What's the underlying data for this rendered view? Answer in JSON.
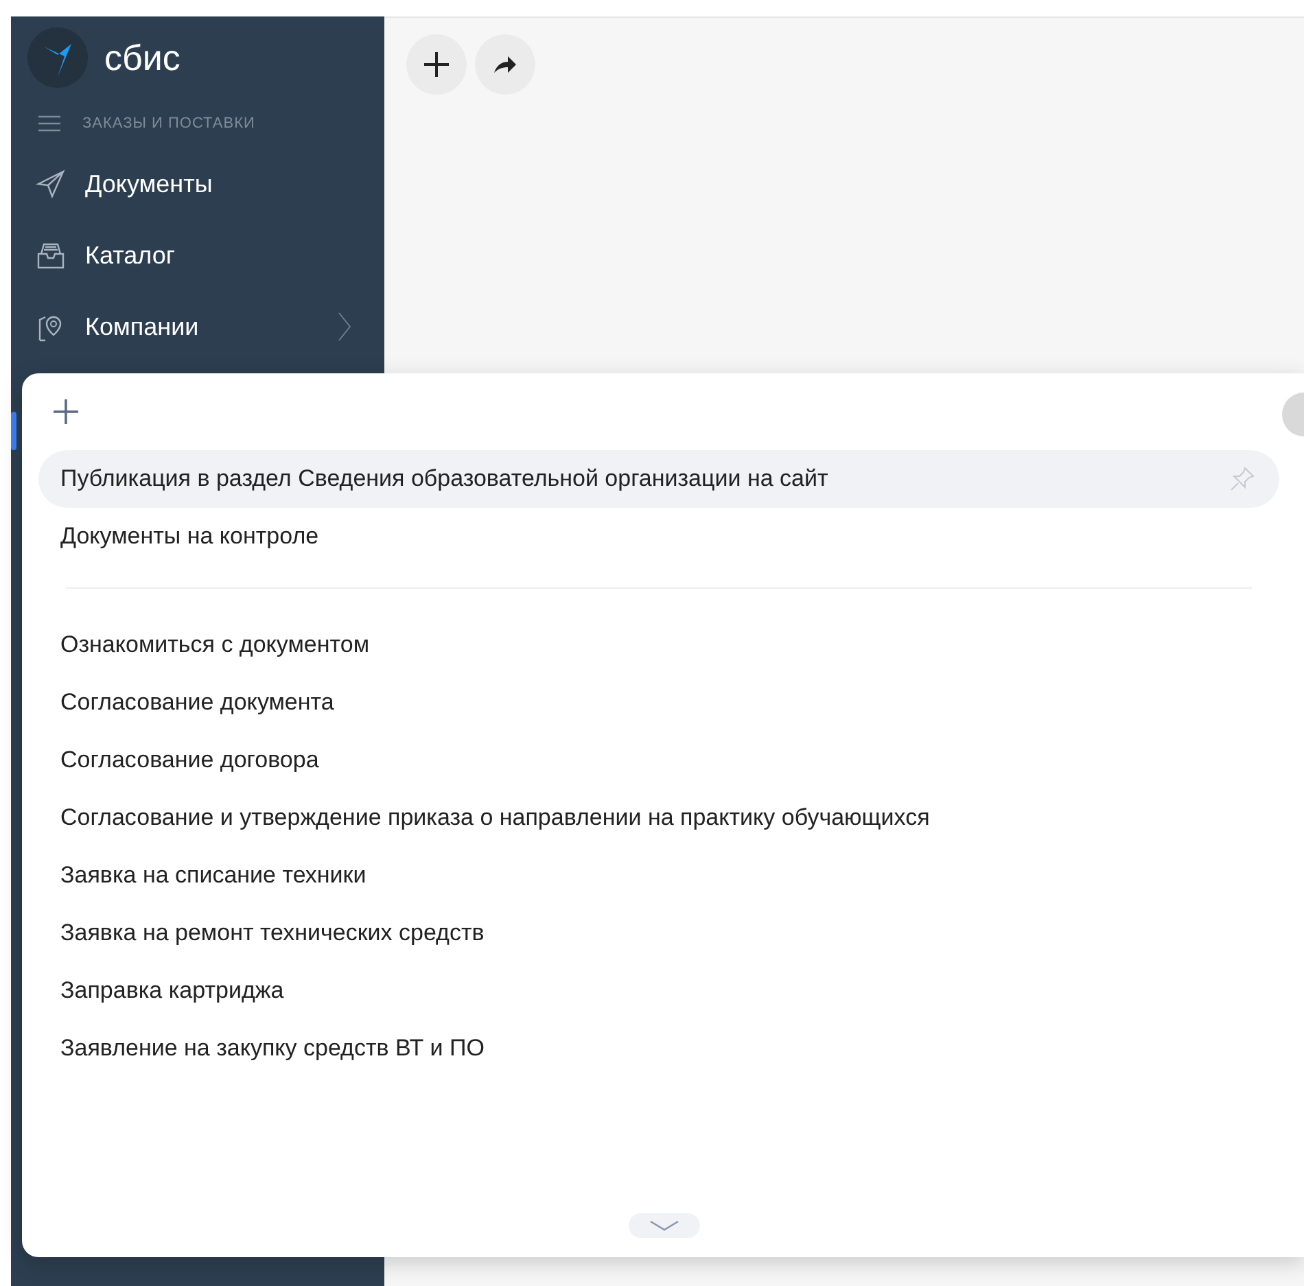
{
  "sidebar": {
    "logo": "сбис",
    "section": "ЗАКАЗЫ И ПОСТАВКИ",
    "items": [
      {
        "kind": "send",
        "label": "Документы",
        "expandable": false
      },
      {
        "kind": "tray",
        "label": "Каталог",
        "expandable": false
      },
      {
        "kind": "pin",
        "label": "Компании",
        "expandable": true
      }
    ]
  },
  "toolbar": {
    "buttons": [
      {
        "kind": "plus"
      },
      {
        "kind": "forward"
      }
    ]
  },
  "popup": {
    "groups": [
      [
        {
          "label": "Публикация в раздел Сведения образовательной организации на сайт",
          "selected": true
        },
        {
          "label": "Документы на контроле",
          "selected": false
        }
      ],
      [
        {
          "label": "Ознакомиться с документом",
          "selected": false
        },
        {
          "label": "Согласование документа",
          "selected": false
        },
        {
          "label": "Согласование договора",
          "selected": false
        },
        {
          "label": "Согласование и утверждение приказа о направлении на практику обучающихся",
          "selected": false
        },
        {
          "label": "Заявка на списание техники",
          "selected": false
        },
        {
          "label": "Заявка на ремонт технических средств",
          "selected": false
        },
        {
          "label": "Заправка картриджа",
          "selected": false
        },
        {
          "label": "Заявление на закупку средств ВТ и ПО",
          "selected": false
        }
      ]
    ]
  }
}
